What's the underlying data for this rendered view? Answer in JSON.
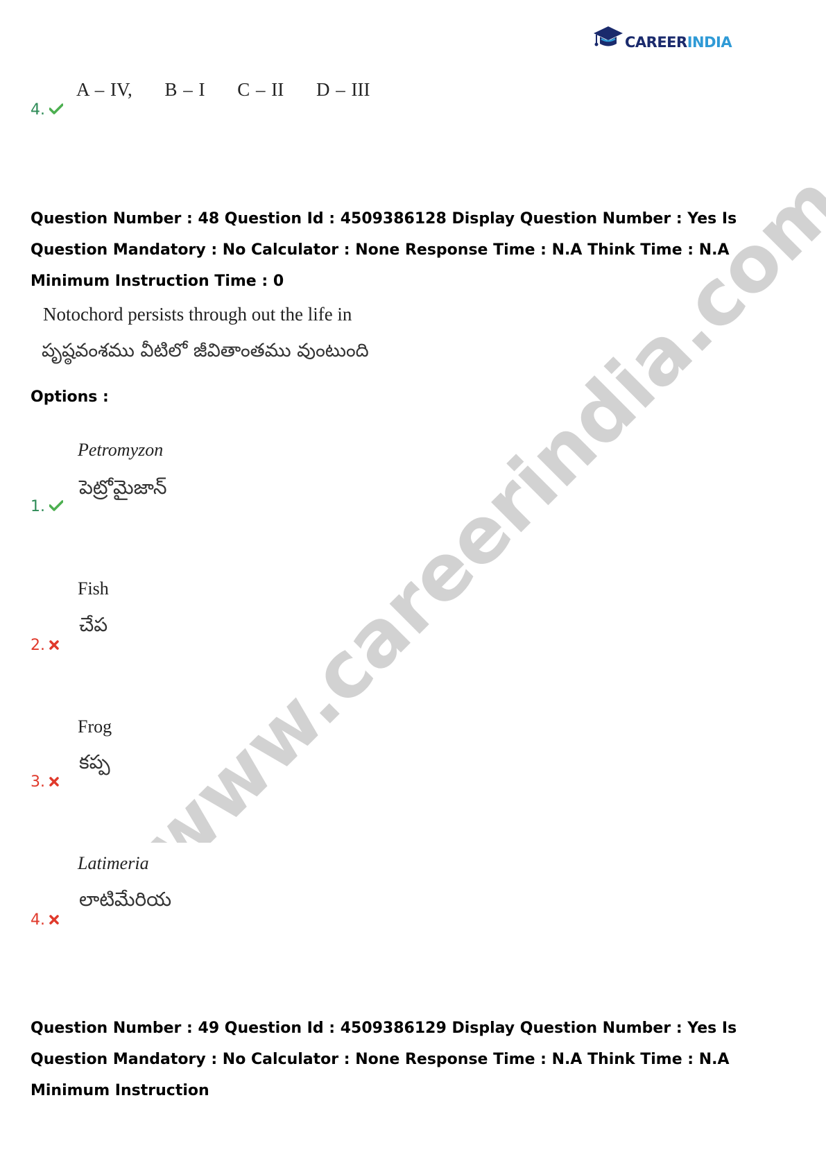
{
  "brand": {
    "part1": "CAREER",
    "part2": "INDIA",
    "colors": {
      "navy": "#1a2a6c",
      "blue": "#2f9ad6"
    }
  },
  "watermark": "www.careerindia.com",
  "previous": {
    "number": "4.",
    "answer": [
      "A – IV,",
      "B – I",
      "C – II",
      "D – III"
    ]
  },
  "q48": {
    "meta": "Question Number : 48 Question Id : 4509386128 Display Question Number : Yes Is Question Mandatory : No Calculator : None Response Time : N.A Think Time : N.A Minimum Instruction Time : 0",
    "text_en": "Notochord persists through out the life in",
    "text_te": "పృష్ఠవంశము వీటిలో జీవితాంతము వుంటుంది",
    "options_label": "Options :",
    "options": [
      {
        "number": "1.",
        "en": "Petromyzon",
        "te": "పెట్రోమైజాన్",
        "correct": true
      },
      {
        "number": "2.",
        "en": "Fish",
        "te": "చేప",
        "correct": false
      },
      {
        "number": "3.",
        "en": "Frog",
        "te": "కప్ప",
        "correct": false
      },
      {
        "number": "4.",
        "en": "Latimeria",
        "te": "లాటిమేరియ",
        "correct": false
      }
    ]
  },
  "q49": {
    "meta": "Question Number : 49 Question Id : 4509386129 Display Question Number : Yes Is Question Mandatory : No Calculator : None Response Time : N.A Think Time : N.A Minimum Instruction"
  },
  "status_colors": {
    "correct": "#2e8b57",
    "wrong": "#e0392b"
  }
}
